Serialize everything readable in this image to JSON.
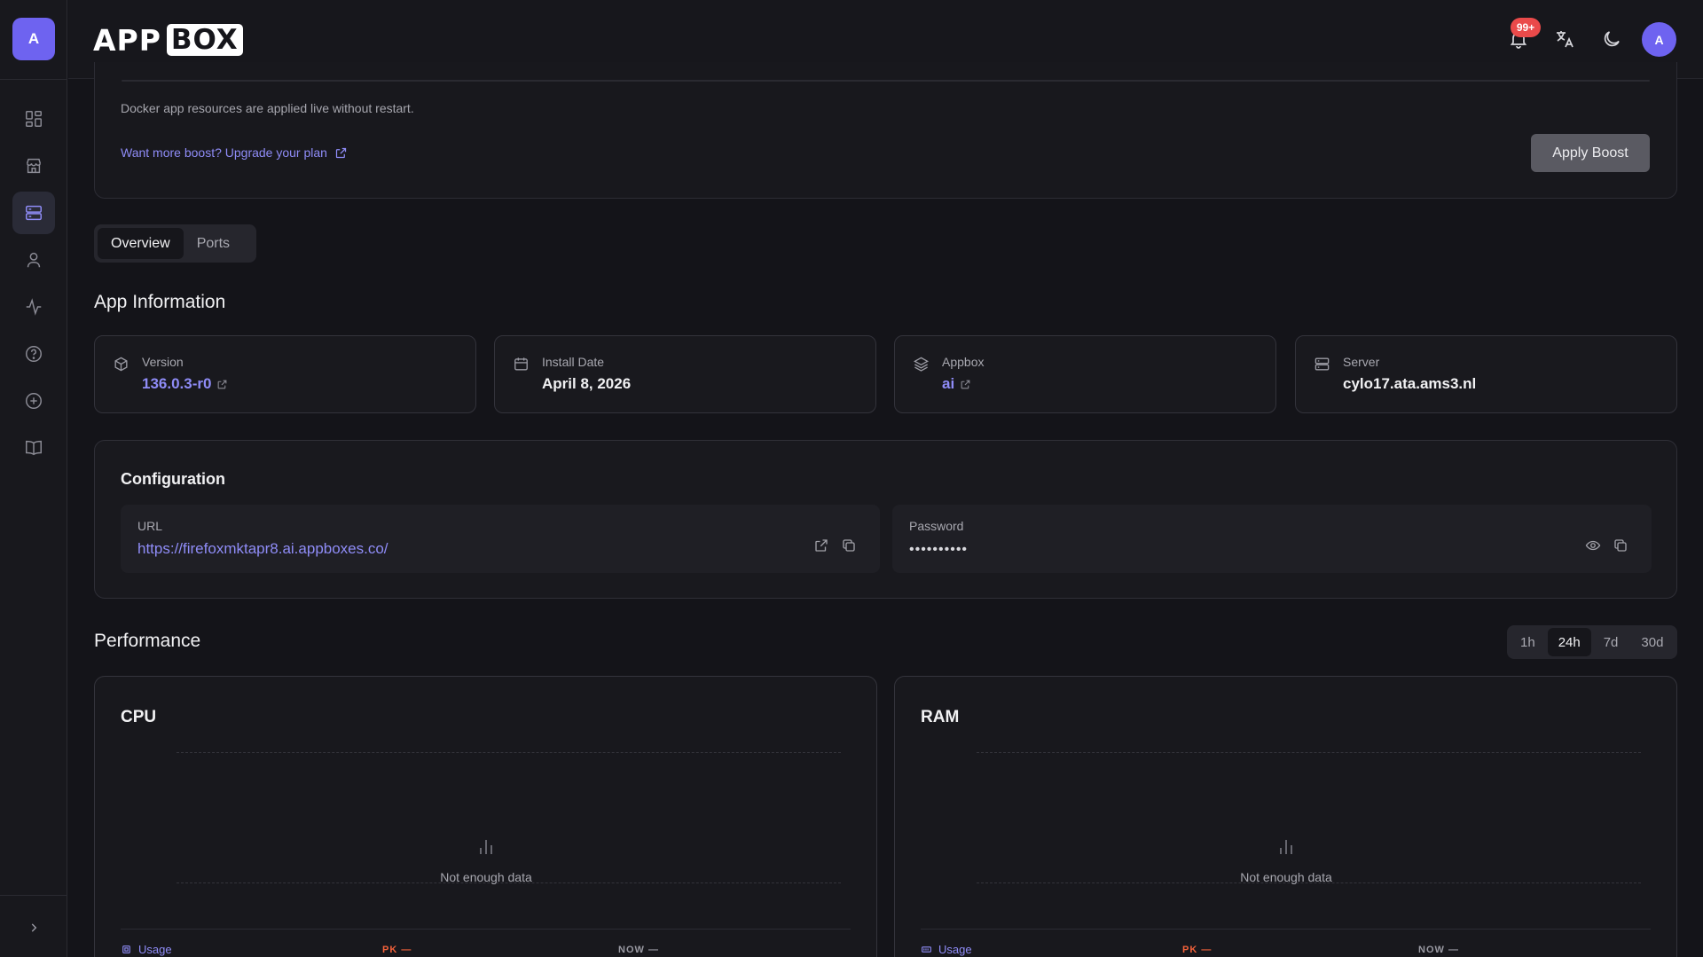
{
  "sidebar": {
    "avatar_letter": "A",
    "items": [
      {
        "name": "dashboard",
        "icon": "grid-icon"
      },
      {
        "name": "store",
        "icon": "store-icon"
      },
      {
        "name": "apps",
        "icon": "server-stack-icon",
        "active": true
      },
      {
        "name": "account",
        "icon": "user-icon"
      },
      {
        "name": "activity",
        "icon": "activity-icon"
      },
      {
        "name": "help",
        "icon": "help-circle-icon"
      },
      {
        "name": "add",
        "icon": "plus-circle-icon"
      },
      {
        "name": "docs",
        "icon": "book-icon"
      }
    ],
    "expand_icon": "chevron-right-icon"
  },
  "header": {
    "logo_app": "APP",
    "logo_box": "BOX",
    "notification_badge": "99+",
    "avatar_letter": "A"
  },
  "boost": {
    "note": "Docker app resources are applied live without restart.",
    "upgrade_link": "Want more boost? Upgrade your plan",
    "apply_button": "Apply Boost"
  },
  "tabs": [
    "Overview",
    "Ports"
  ],
  "app_info": {
    "title": "App Information",
    "cards": [
      {
        "label": "Version",
        "value": "136.0.3-r0",
        "icon": "package-icon"
      },
      {
        "label": "Install Date",
        "value": "April 8, 2026",
        "icon": "calendar-icon"
      },
      {
        "label": "Appbox",
        "value": "ai",
        "icon": "layers-icon"
      },
      {
        "label": "Server",
        "value": "cylo17.ata.ams3.nl",
        "icon": "server-icon"
      }
    ]
  },
  "configuration": {
    "title": "Configuration",
    "url_label": "URL",
    "url_value": "https://firefoxmktapr8.ai.appboxes.co/",
    "password_label": "Password",
    "password_value": "••••••••••"
  },
  "performance": {
    "title": "Performance",
    "ranges": [
      "1h",
      "24h",
      "7d",
      "30d"
    ],
    "active_range": "24h",
    "charts": [
      {
        "title": "CPU",
        "empty_text": "Not enough data",
        "usage_label": "Usage",
        "pk_label": "PK —",
        "now_label": "NOW —"
      },
      {
        "title": "RAM",
        "empty_text": "Not enough data",
        "usage_label": "Usage",
        "pk_label": "PK —",
        "now_label": "NOW —"
      }
    ]
  },
  "colors": {
    "accent": "#8f8cf7",
    "avatar": "#6e63f0",
    "badge": "#ea4a4a",
    "peak": "#f2613a"
  }
}
